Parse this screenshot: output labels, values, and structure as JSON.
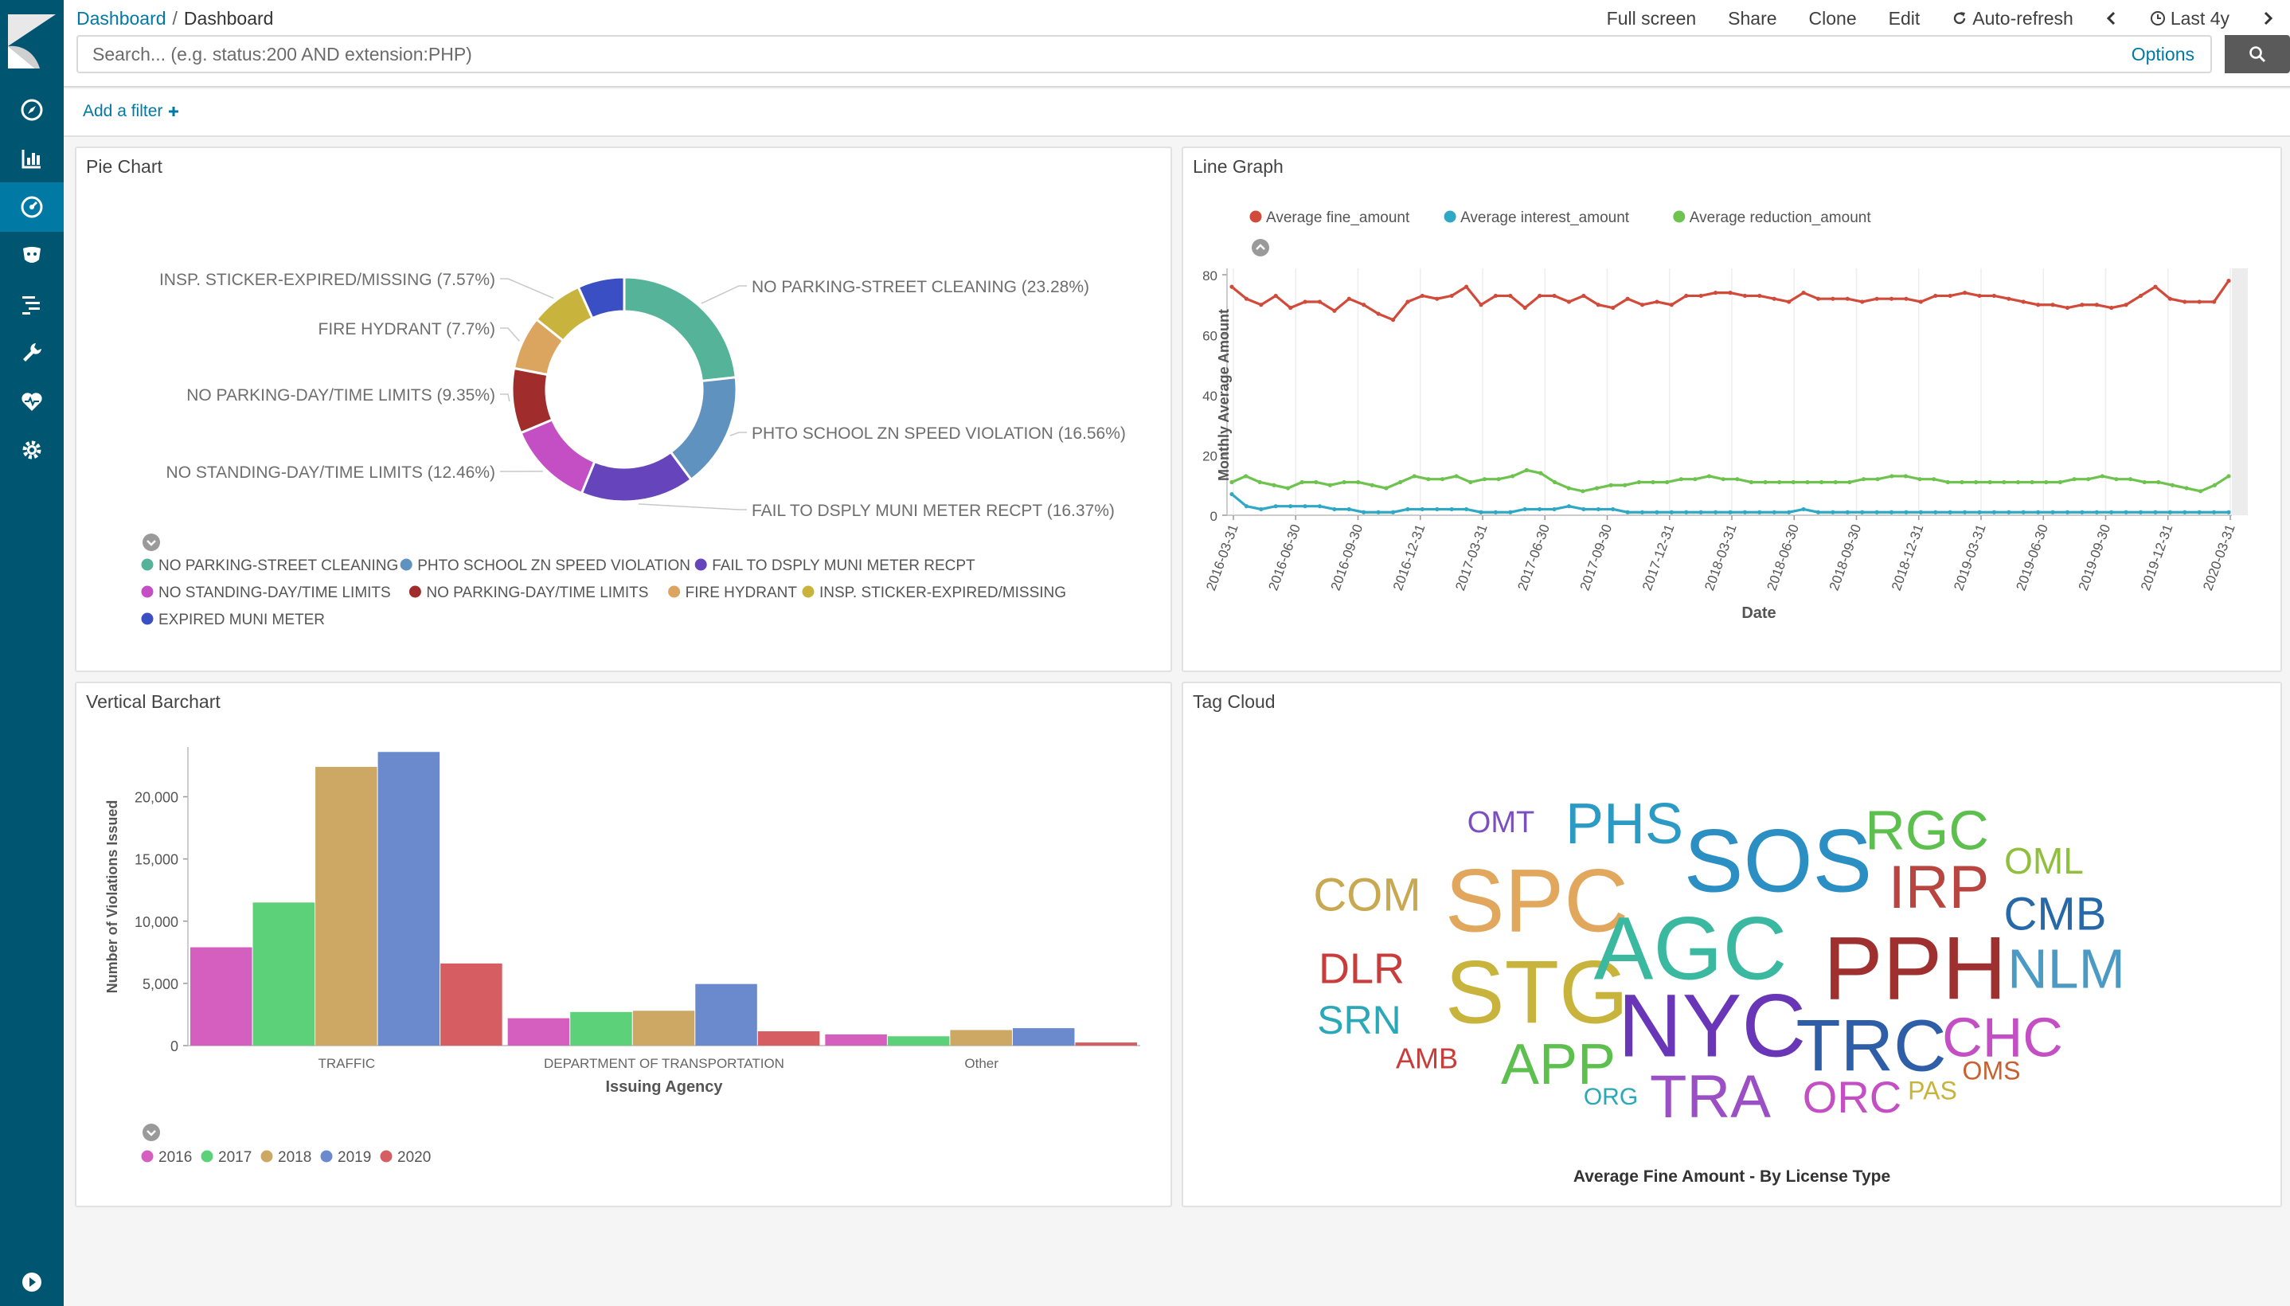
{
  "breadcrumb": {
    "root": "Dashboard",
    "current": "Dashboard"
  },
  "topnav": [
    "Full screen",
    "Share",
    "Clone",
    "Edit"
  ],
  "auto_refresh": "Auto-refresh",
  "time_range": "Last 4y",
  "search": {
    "placeholder": "Search... (e.g. status:200 AND extension:PHP)",
    "options_label": "Options"
  },
  "filter": {
    "add_label": "Add a filter"
  },
  "colors": {
    "sidebar": "#005571",
    "sidebar_active": "#0079a5",
    "link": "#0079a5"
  },
  "sidebar_icons": [
    "discover-icon",
    "visualize-icon",
    "dashboard-icon",
    "timelion-icon",
    "apm-icon",
    "devtools-icon",
    "monitoring-icon",
    "management-icon",
    "collapse-icon"
  ],
  "panels": {
    "pie": {
      "title": "Pie Chart",
      "chart_data": {
        "type": "pie",
        "donut": true,
        "slices": [
          {
            "label": "NO PARKING-STREET CLEANING",
            "pct_label": "(23.28%)",
            "value": 23.28,
            "color": "#54B399"
          },
          {
            "label": "PHTO SCHOOL ZN SPEED VIOLATION",
            "pct_label": "(16.56%)",
            "value": 16.56,
            "color": "#6092C0"
          },
          {
            "label": "FAIL TO DSPLY MUNI METER RECPT",
            "pct_label": "(16.37%)",
            "value": 16.37,
            "color": "#6644BB"
          },
          {
            "label": "NO STANDING-DAY/TIME LIMITS",
            "pct_label": "(12.46%)",
            "value": 12.46,
            "color": "#C44FC4"
          },
          {
            "label": "NO PARKING-DAY/TIME LIMITS",
            "pct_label": "(9.35%)",
            "value": 9.35,
            "color": "#A02C2C"
          },
          {
            "label": "FIRE HYDRANT",
            "pct_label": "(7.7%)",
            "value": 7.7,
            "color": "#DCA55F"
          },
          {
            "label": "INSP. STICKER-EXPIRED/MISSING",
            "pct_label": "(7.57%)",
            "value": 7.57,
            "color": "#C8B43C"
          },
          {
            "label": "EXPIRED MUNI METER",
            "pct_label": "",
            "value": 6.71,
            "color": "#3A4FC4"
          }
        ],
        "legend_position": "bottom"
      }
    },
    "line": {
      "title": "Line Graph",
      "chart_data": {
        "type": "line",
        "xlabel": "Date",
        "ylabel": "Monthly Average Amount",
        "ylim": [
          0,
          80
        ],
        "yticks": [
          0,
          20,
          40,
          60,
          80
        ],
        "xtick_labels": [
          "2016-03-31",
          "2016-06-30",
          "2016-09-30",
          "2016-12-31",
          "2017-03-31",
          "2017-06-30",
          "2017-09-30",
          "2017-12-31",
          "2018-03-31",
          "2018-06-30",
          "2018-09-30",
          "2018-12-31",
          "2019-03-31",
          "2019-06-30",
          "2019-09-30",
          "2019-12-31",
          "2020-03-31"
        ],
        "legend_position": "top-left",
        "series": [
          {
            "name": "Average fine_amount",
            "color": "#D14A3A",
            "values": [
              76,
              72,
              70,
              73,
              69,
              71,
              71,
              68,
              72,
              70,
              67,
              65,
              71,
              73,
              72,
              73,
              76,
              70,
              73,
              73,
              69,
              73,
              73,
              71,
              73,
              70,
              69,
              72,
              70,
              71,
              70,
              73,
              73,
              74,
              74,
              73,
              73,
              72,
              71,
              74,
              72,
              72,
              72,
              71,
              72,
              72,
              72,
              71,
              73,
              73,
              74,
              73,
              73,
              72,
              71,
              70,
              70,
              69,
              70,
              70,
              69,
              70,
              73,
              76,
              72,
              71,
              71,
              71,
              78
            ]
          },
          {
            "name": "Average interest_amount",
            "color": "#2EA8C4",
            "values": [
              7,
              3,
              2,
              3,
              3,
              3,
              3,
              2,
              2,
              1,
              1,
              1,
              2,
              2,
              2,
              2,
              2,
              1,
              1,
              1,
              2,
              2,
              2,
              3,
              2,
              2,
              2,
              1,
              1,
              1,
              1,
              1,
              1,
              1,
              1,
              1,
              1,
              1,
              1,
              2,
              1,
              1,
              1,
              1,
              1,
              1,
              1,
              1,
              1,
              1,
              1,
              1,
              1,
              1,
              1,
              1,
              1,
              1,
              1,
              1,
              1,
              1,
              1,
              1,
              1,
              1,
              1,
              1,
              1
            ]
          },
          {
            "name": "Average reduction_amount",
            "color": "#6DC34E",
            "values": [
              11,
              13,
              11,
              10,
              9,
              11,
              11,
              10,
              11,
              11,
              10,
              9,
              11,
              13,
              12,
              12,
              13,
              11,
              12,
              12,
              13,
              15,
              14,
              11,
              9,
              8,
              9,
              10,
              10,
              11,
              11,
              11,
              12,
              12,
              13,
              12,
              12,
              11,
              11,
              11,
              11,
              11,
              11,
              11,
              11,
              12,
              12,
              13,
              13,
              12,
              12,
              11,
              11,
              11,
              11,
              11,
              11,
              11,
              11,
              11,
              12,
              12,
              13,
              12,
              12,
              11,
              11,
              10,
              9,
              8,
              10,
              13
            ]
          }
        ]
      }
    },
    "bar": {
      "title": "Vertical Barchart",
      "chart_data": {
        "type": "bar",
        "xlabel": "Issuing Agency",
        "ylabel": "Number of Violations Issued",
        "ylim": [
          0,
          24000
        ],
        "yticks": [
          0,
          5000,
          10000,
          15000,
          20000
        ],
        "ytick_labels": [
          "0",
          "5,000",
          "10,000",
          "15,000",
          "20,000"
        ],
        "categories": [
          "TRAFFIC",
          "DEPARTMENT OF TRANSPORTATION",
          "Other"
        ],
        "series": [
          {
            "name": "2016",
            "color": "#D45FBE",
            "values": [
              7900,
              2200,
              900
            ]
          },
          {
            "name": "2017",
            "color": "#5DD07A",
            "values": [
              11500,
              2700,
              750
            ]
          },
          {
            "name": "2018",
            "color": "#CDA864",
            "values": [
              22400,
              2800,
              1250
            ]
          },
          {
            "name": "2019",
            "color": "#6A8ACD",
            "values": [
              23600,
              4950,
              1400
            ]
          },
          {
            "name": "2020",
            "color": "#D65E62",
            "values": [
              6600,
              1150,
              250
            ]
          }
        ],
        "legend_position": "bottom"
      }
    },
    "tag": {
      "title": "Tag Cloud",
      "caption": "Average Fine Amount - By License Type",
      "tags": [
        {
          "text": "OMT",
          "size": 38,
          "color": "#7B4FBF",
          "pos": [
            1885,
            1035
          ]
        },
        {
          "text": "PHS",
          "size": 72,
          "color": "#2B9AC4",
          "pos": [
            2040,
            1040
          ]
        },
        {
          "text": "SOS",
          "size": 112,
          "color": "#2B8FC4",
          "pos": [
            2233,
            1090
          ]
        },
        {
          "text": "RGC",
          "size": 70,
          "color": "#5DBF4E",
          "pos": [
            2420,
            1048
          ]
        },
        {
          "text": "COM",
          "size": 58,
          "color": "#C8A850",
          "pos": [
            1717,
            1128
          ]
        },
        {
          "text": "SPC",
          "size": 112,
          "color": "#E1A75C",
          "pos": [
            1930,
            1140
          ]
        },
        {
          "text": "IRP",
          "size": 76,
          "color": "#B84540",
          "pos": [
            2435,
            1120
          ]
        },
        {
          "text": "OML",
          "size": 46,
          "color": "#8FBF3C",
          "pos": [
            2567,
            1085
          ]
        },
        {
          "text": "CMB",
          "size": 58,
          "color": "#2668A8",
          "pos": [
            2581,
            1152
          ]
        },
        {
          "text": "DLR",
          "size": 54,
          "color": "#C83C3C",
          "pos": [
            1710,
            1220
          ]
        },
        {
          "text": "STG",
          "size": 112,
          "color": "#C8B43C",
          "pos": [
            1930,
            1255
          ]
        },
        {
          "text": "AGC",
          "size": 112,
          "color": "#3BB8A0",
          "pos": [
            2123,
            1200
          ]
        },
        {
          "text": "PPH",
          "size": 112,
          "color": "#9E3030",
          "pos": [
            2405,
            1225
          ]
        },
        {
          "text": "NLM",
          "size": 70,
          "color": "#4A9AC4",
          "pos": [
            2595,
            1222
          ]
        },
        {
          "text": "NYC",
          "size": 112,
          "color": "#6A36B8",
          "pos": [
            2150,
            1297
          ]
        },
        {
          "text": "SRN",
          "size": 50,
          "color": "#2BA8B8",
          "pos": [
            1707,
            1285
          ]
        },
        {
          "text": "TRC",
          "size": 92,
          "color": "#2E5EA8",
          "pos": [
            2350,
            1320
          ]
        },
        {
          "text": "CHC",
          "size": 70,
          "color": "#C44FC4",
          "pos": [
            2515,
            1308
          ]
        },
        {
          "text": "AMB",
          "size": 36,
          "color": "#C83C3C",
          "pos": [
            1792,
            1332
          ]
        },
        {
          "text": "APP",
          "size": 72,
          "color": "#5DBF4E",
          "pos": [
            1957,
            1342
          ]
        },
        {
          "text": "OMS",
          "size": 32,
          "color": "#C86030",
          "pos": [
            2501,
            1347
          ]
        },
        {
          "text": "ORG",
          "size": 30,
          "color": "#2BA8B8",
          "pos": [
            2023,
            1379
          ]
        },
        {
          "text": "TRA",
          "size": 76,
          "color": "#9B4FC4",
          "pos": [
            2148,
            1383
          ]
        },
        {
          "text": "ORC",
          "size": 56,
          "color": "#C44FC4",
          "pos": [
            2326,
            1382
          ]
        },
        {
          "text": "PAS",
          "size": 32,
          "color": "#C8B43C",
          "pos": [
            2427,
            1372
          ]
        }
      ]
    }
  }
}
